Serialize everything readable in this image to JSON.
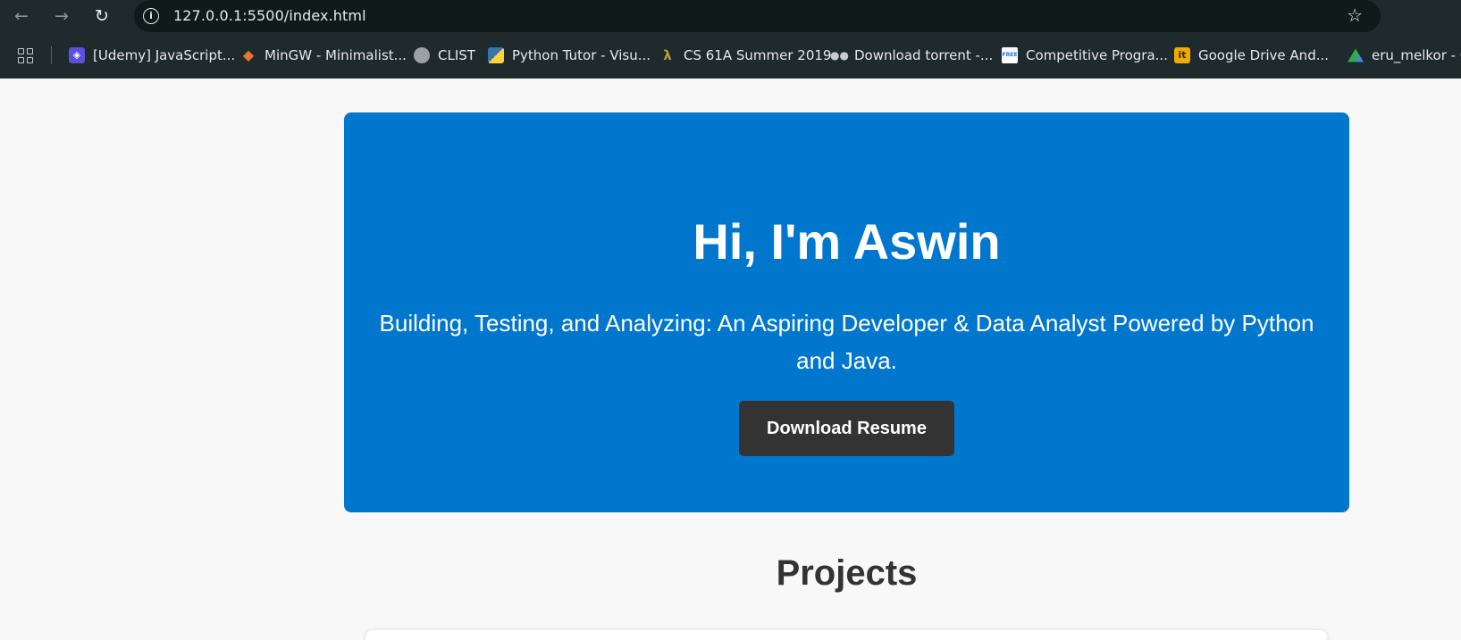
{
  "browser": {
    "url": "127.0.0.1:5500/index.html",
    "icons": [
      "back-arrow-icon",
      "forward-arrow-icon",
      "reload-icon",
      "site-info-icon",
      "bookmark-star-icon",
      "apps-grid-icon"
    ],
    "bookmarks": [
      {
        "label": "[Udemy] JavaScript...",
        "icon": "udemy-icon",
        "color": "#5b4fe0"
      },
      {
        "label": "MinGW - Minimalist...",
        "icon": "mingw-icon",
        "color": "#e8762c"
      },
      {
        "label": "CLIST",
        "icon": "globe-icon",
        "color": "#9aa0a6"
      },
      {
        "label": "Python Tutor - Visu...",
        "icon": "python-icon",
        "color": "#3776ab"
      },
      {
        "label": "CS 61A Summer 2019",
        "icon": "lambda-icon",
        "color": "#b5a33a"
      },
      {
        "label": "Download torrent -...",
        "icon": "glasses-icon",
        "color": "#c8ccce"
      },
      {
        "label": "Competitive Progra...",
        "icon": "free-badge-icon",
        "color": "#1a73e8"
      },
      {
        "label": "Google Drive And...",
        "icon": "it-icon",
        "color": "#f2a900"
      },
      {
        "label": "eru_melkor - Go",
        "icon": "google-drive-icon",
        "color": "#34a853"
      }
    ]
  },
  "hero": {
    "title": "Hi, I'm Aswin",
    "tagline": "Building, Testing, and Analyzing: An Aspiring Developer & Data Analyst Powered by Python and Java.",
    "button_label": "Download Resume",
    "background": "#0077cc",
    "button_color": "#333333"
  },
  "projects": {
    "title": "Projects"
  }
}
